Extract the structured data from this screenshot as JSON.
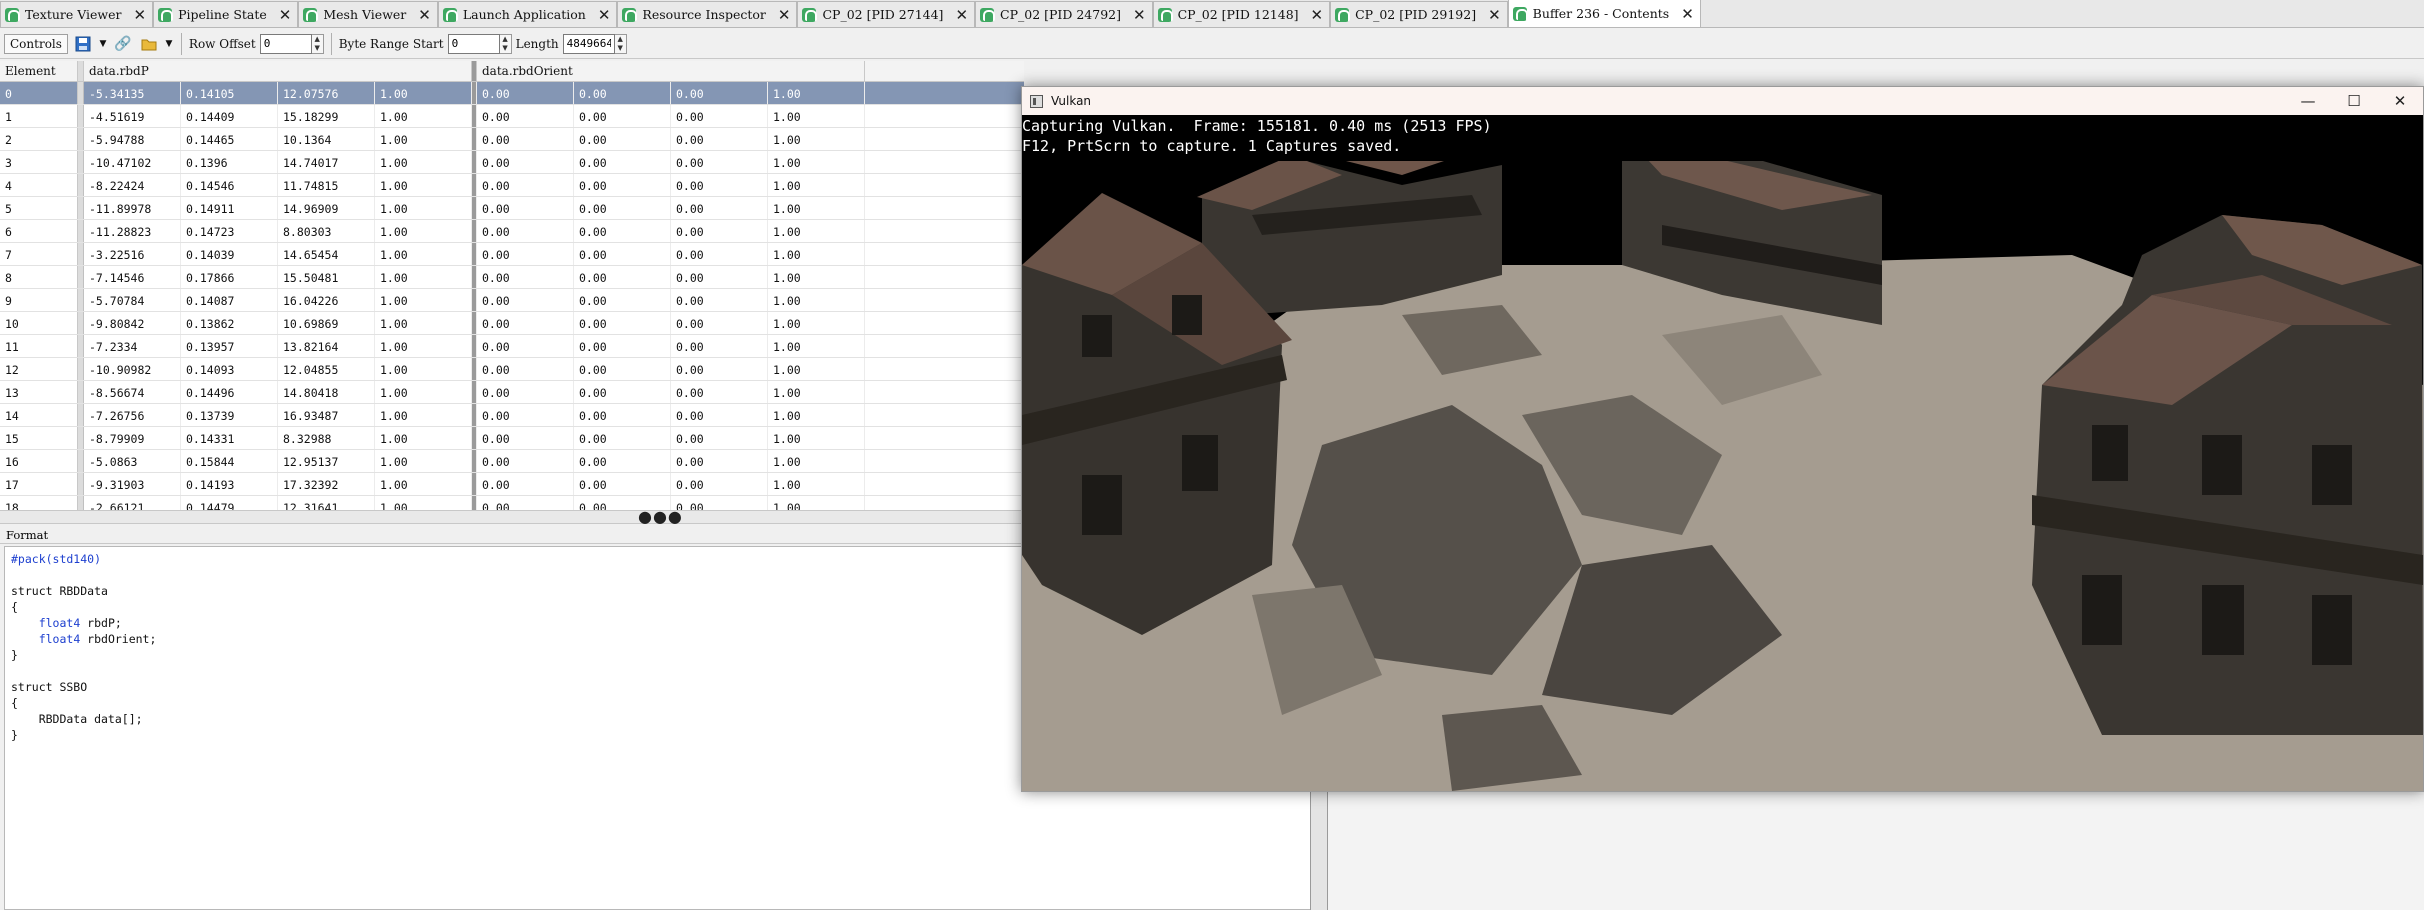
{
  "tabs": [
    {
      "label": "Texture Viewer"
    },
    {
      "label": "Pipeline State"
    },
    {
      "label": "Mesh Viewer"
    },
    {
      "label": "Launch Application"
    },
    {
      "label": "Resource Inspector"
    },
    {
      "label": "CP_02 [PID 27144]"
    },
    {
      "label": "CP_02 [PID 24792]"
    },
    {
      "label": "CP_02 [PID 12148]"
    },
    {
      "label": "CP_02 [PID 29192]"
    },
    {
      "label": "Buffer 236 - Contents"
    }
  ],
  "toolbar": {
    "controls_label": "Controls",
    "row_offset_label": "Row Offset",
    "row_offset_value": "0",
    "byte_range_label": "Byte Range Start",
    "byte_range_value": "0",
    "length_label": "Length",
    "length_value": "4849664"
  },
  "table": {
    "headers": {
      "element": "Element",
      "rbdP": "data.rbdP",
      "rbdOrient": "data.rbdOrient"
    },
    "rows": [
      {
        "el": "0",
        "p": [
          "-5.34135",
          "0.14105",
          "12.07576",
          "1.00"
        ],
        "o": [
          "0.00",
          "0.00",
          "0.00",
          "1.00"
        ]
      },
      {
        "el": "1",
        "p": [
          "-4.51619",
          "0.14409",
          "15.18299",
          "1.00"
        ],
        "o": [
          "0.00",
          "0.00",
          "0.00",
          "1.00"
        ]
      },
      {
        "el": "2",
        "p": [
          "-5.94788",
          "0.14465",
          "10.1364",
          "1.00"
        ],
        "o": [
          "0.00",
          "0.00",
          "0.00",
          "1.00"
        ]
      },
      {
        "el": "3",
        "p": [
          "-10.47102",
          "0.1396",
          "14.74017",
          "1.00"
        ],
        "o": [
          "0.00",
          "0.00",
          "0.00",
          "1.00"
        ]
      },
      {
        "el": "4",
        "p": [
          "-8.22424",
          "0.14546",
          "11.74815",
          "1.00"
        ],
        "o": [
          "0.00",
          "0.00",
          "0.00",
          "1.00"
        ]
      },
      {
        "el": "5",
        "p": [
          "-11.89978",
          "0.14911",
          "14.96909",
          "1.00"
        ],
        "o": [
          "0.00",
          "0.00",
          "0.00",
          "1.00"
        ]
      },
      {
        "el": "6",
        "p": [
          "-11.28823",
          "0.14723",
          "8.80303",
          "1.00"
        ],
        "o": [
          "0.00",
          "0.00",
          "0.00",
          "1.00"
        ]
      },
      {
        "el": "7",
        "p": [
          "-3.22516",
          "0.14039",
          "14.65454",
          "1.00"
        ],
        "o": [
          "0.00",
          "0.00",
          "0.00",
          "1.00"
        ]
      },
      {
        "el": "8",
        "p": [
          "-7.14546",
          "0.17866",
          "15.50481",
          "1.00"
        ],
        "o": [
          "0.00",
          "0.00",
          "0.00",
          "1.00"
        ]
      },
      {
        "el": "9",
        "p": [
          "-5.70784",
          "0.14087",
          "16.04226",
          "1.00"
        ],
        "o": [
          "0.00",
          "0.00",
          "0.00",
          "1.00"
        ]
      },
      {
        "el": "10",
        "p": [
          "-9.80842",
          "0.13862",
          "10.69869",
          "1.00"
        ],
        "o": [
          "0.00",
          "0.00",
          "0.00",
          "1.00"
        ]
      },
      {
        "el": "11",
        "p": [
          "-7.2334",
          "0.13957",
          "13.82164",
          "1.00"
        ],
        "o": [
          "0.00",
          "0.00",
          "0.00",
          "1.00"
        ]
      },
      {
        "el": "12",
        "p": [
          "-10.90982",
          "0.14093",
          "12.04855",
          "1.00"
        ],
        "o": [
          "0.00",
          "0.00",
          "0.00",
          "1.00"
        ]
      },
      {
        "el": "13",
        "p": [
          "-8.56674",
          "0.14496",
          "14.80418",
          "1.00"
        ],
        "o": [
          "0.00",
          "0.00",
          "0.00",
          "1.00"
        ]
      },
      {
        "el": "14",
        "p": [
          "-7.26756",
          "0.13739",
          "16.93487",
          "1.00"
        ],
        "o": [
          "0.00",
          "0.00",
          "0.00",
          "1.00"
        ]
      },
      {
        "el": "15",
        "p": [
          "-8.79909",
          "0.14331",
          "8.32988",
          "1.00"
        ],
        "o": [
          "0.00",
          "0.00",
          "0.00",
          "1.00"
        ]
      },
      {
        "el": "16",
        "p": [
          "-5.0863",
          "0.15844",
          "12.95137",
          "1.00"
        ],
        "o": [
          "0.00",
          "0.00",
          "0.00",
          "1.00"
        ]
      },
      {
        "el": "17",
        "p": [
          "-9.31903",
          "0.14193",
          "17.32392",
          "1.00"
        ],
        "o": [
          "0.00",
          "0.00",
          "0.00",
          "1.00"
        ]
      },
      {
        "el": "18",
        "p": [
          "-2.66121",
          "0.14479",
          "12.31641",
          "1.00"
        ],
        "o": [
          "0.00",
          "0.00",
          "0.00",
          "1.00"
        ]
      }
    ]
  },
  "format": {
    "header": "Format",
    "code": [
      {
        "text": "#pack(std140)",
        "kw": true
      },
      {
        "text": "",
        "kw": false
      },
      {
        "text": "struct RBDData",
        "kw": false
      },
      {
        "text": "{",
        "kw": false
      },
      {
        "text": "    float4 rbdP;",
        "kw": false,
        "kwprefix": "float4"
      },
      {
        "text": "    float4 rbdOrient;",
        "kw": false,
        "kwprefix": "float4"
      },
      {
        "text": "}",
        "kw": false
      },
      {
        "text": "",
        "kw": false
      },
      {
        "text": "struct SSBO",
        "kw": false
      },
      {
        "text": "{",
        "kw": false
      },
      {
        "text": "    RBDData data[];",
        "kw": false
      },
      {
        "text": "}",
        "kw": false
      }
    ]
  },
  "vulkan": {
    "title": "Vulkan",
    "overlay_line1": "Capturing Vulkan.  Frame: 155181. 0.40 ms (2513 FPS)",
    "overlay_line2": "F12, PrtScrn to capture. 1 Captures saved."
  },
  "colors": {
    "selection": "#8496b4",
    "tab_icon": "#3ea861",
    "keyword": "#1d3fcf",
    "ground": "#a59c90",
    "wall": "#3b3833",
    "roof": "#6a5348"
  }
}
